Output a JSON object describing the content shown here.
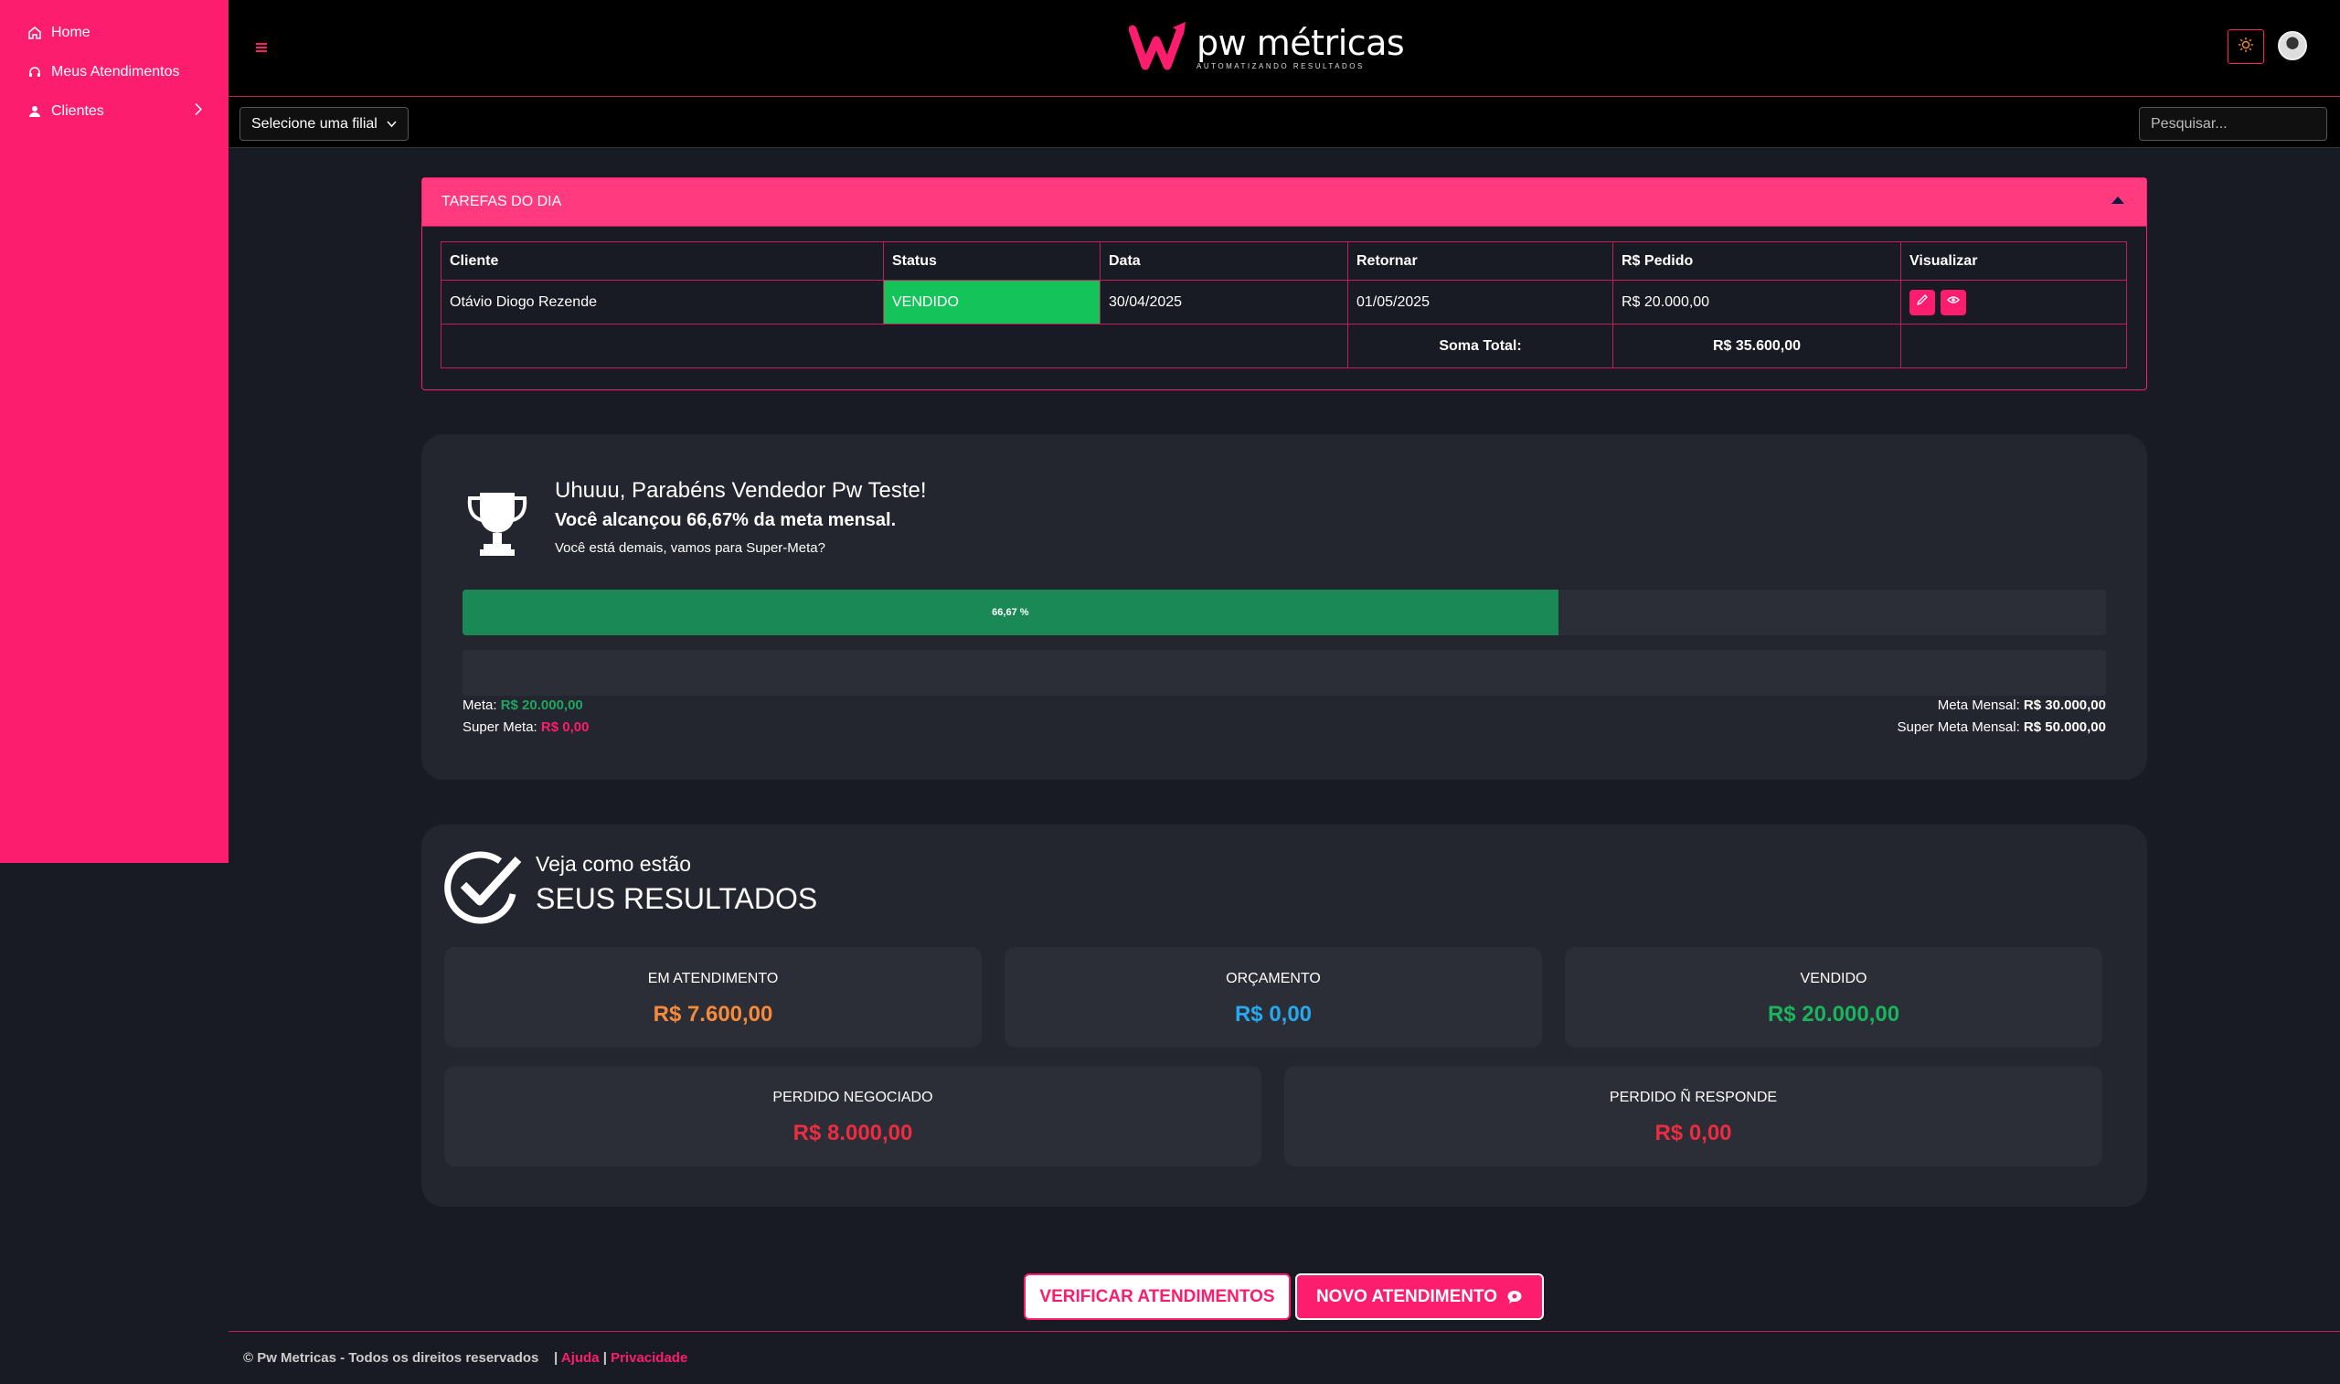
{
  "sidebar": {
    "items": [
      {
        "label": "Home",
        "icon": "home-icon"
      },
      {
        "label": "Meus Atendimentos",
        "icon": "headset-icon"
      },
      {
        "label": "Clientes",
        "icon": "user-icon"
      }
    ]
  },
  "header": {
    "logo_main": "pw métricas",
    "logo_sub": "AUTOMATIZANDO RESULTADOS",
    "branch_select": "Selecione uma filial",
    "search_placeholder": "Pesquisar..."
  },
  "tasks": {
    "title": "TAREFAS DO DIA",
    "columns": [
      "Cliente",
      "Status",
      "Data",
      "Retornar",
      "R$ Pedido",
      "Visualizar"
    ],
    "rows": [
      {
        "cliente": "Otávio Diogo Rezende",
        "status": "VENDIDO",
        "data": "30/04/2025",
        "retornar": "01/05/2025",
        "pedido": "R$ 20.000,00"
      }
    ],
    "total_label": "Soma Total:",
    "total_value": "R$ 35.600,00"
  },
  "meta": {
    "title": "Uhuuu, Parabéns Vendedor Pw Teste!",
    "subtitle": "Você alcançou 66,67% da meta mensal.",
    "message": "Você está demais, vamos para Super-Meta?",
    "progress_label": "66,67 %",
    "progress_fraction": 0.6667,
    "super_progress_fraction": 0,
    "meta_label": "Meta:",
    "meta_value": "R$ 20.000,00",
    "super_label": "Super Meta:",
    "super_value": "R$ 0,00",
    "monthly_label": "Meta Mensal:",
    "monthly_value": "R$ 30.000,00",
    "super_monthly_label": "Super Meta Mensal:",
    "super_monthly_value": "R$ 50.000,00"
  },
  "results": {
    "small": "Veja como estão",
    "big": "SEUS RESULTADOS",
    "cards": [
      {
        "label": "EM ATENDIMENTO",
        "value": "R$ 7.600,00",
        "color": "#f68a3a"
      },
      {
        "label": "ORÇAMENTO",
        "value": "R$ 0,00",
        "color": "#28a8ee"
      },
      {
        "label": "VENDIDO",
        "value": "R$ 20.000,00",
        "color": "#18b55d"
      },
      {
        "label": "PERDIDO NEGOCIADO",
        "value": "R$ 8.000,00",
        "color": "#ec2c40"
      },
      {
        "label": "PERDIDO Ñ RESPONDE",
        "value": "R$ 0,00",
        "color": "#ec2c40"
      }
    ]
  },
  "buttons": {
    "verify": "VERIFICAR ATENDIMENTOS",
    "new": "NOVO ATENDIMENTO"
  },
  "footer": {
    "copyright": "© Pw Metricas - Todos os direitos reservados",
    "help": "Ajuda",
    "privacy": "Privacidade"
  },
  "colors": {
    "brand": "#fc1d6f",
    "background": "#181a24",
    "card": "#23252f"
  }
}
